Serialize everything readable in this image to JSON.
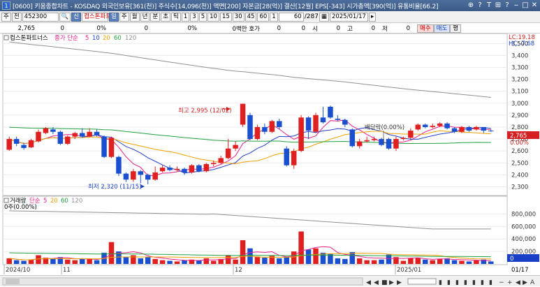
{
  "window": {
    "number": "1",
    "title": "[0600] 키움종합차트 - KOSDAQ 외국인보유[361(천)] 주식수[14,096(천)] 액면[200] 자본금[28(억)] 결산[12월] EPS[-343] 시가총액[390(억)] 유통비율[66.2]",
    "controls": [
      "⊕",
      "?",
      "T",
      "⊞",
      "?",
      "‒",
      "□",
      "✕"
    ]
  },
  "toolbar": {
    "market": "주",
    "period_mode": "전",
    "code": "452300",
    "stock_name": "컵스톤파트",
    "buttons": [
      "일",
      "주",
      "월",
      "년",
      "분",
      "초",
      "틱"
    ],
    "active_button": "일",
    "intervals": [
      "1",
      "3",
      "5",
      "10",
      "15",
      "30",
      "45",
      "60"
    ],
    "interval_dropdown": "1",
    "count_value": "60",
    "count_total": "/287",
    "date": "2025/01/17"
  },
  "infobar": {
    "price": "2,765",
    "change": "0",
    "change_pct": "0%",
    "volume": "0",
    "volume_pct": "0%",
    "ask_label": "0백만 호가",
    "ask_value": "0",
    "open_label": "시",
    "open_value": "0",
    "high_label": "고",
    "high_value": "0",
    "low_label": "저",
    "low_value": "0",
    "buy_label": "매수",
    "sell_label": "매도",
    "flat_label": "평"
  },
  "price_panel": {
    "legend_name": "컵스톤파트너스",
    "legend_ma_label": "종가 단순",
    "ma_periods": [
      "5",
      "10",
      "20",
      "60",
      "120"
    ],
    "ma_colors": [
      "#e8208a",
      "#2040c8",
      "#f0a000",
      "#20a040",
      "#909090"
    ],
    "lc_label": "LC:19.18",
    "hc_label": "HC:-7.68",
    "current_price_tag": "2,765",
    "current_pct_tag": "0.00%",
    "high_annotation": "최고 2,995 (12/02)",
    "low_annotation": "최저 2,320 (11/15)",
    "dividend_annotation": "배당락(0.00%)"
  },
  "volume_panel": {
    "legend_name": "거래량",
    "legend_ma_label": "단순",
    "ma_periods": [
      "5",
      "20",
      "60",
      "120"
    ],
    "sublabel": "0주(0.00%)",
    "current_tag": "0"
  },
  "x_axis": {
    "labels": [
      "2024/10",
      "11",
      "12",
      "2025/01"
    ],
    "right_label": "01/17"
  },
  "chart_data": {
    "type": "candlestick",
    "y_price_ticks": [
      "3,500",
      "3,400",
      "3,300",
      "3,200",
      "3,100",
      "3,000",
      "2,900",
      "2,800",
      "2,700",
      "2,600",
      "2,500",
      "2,400",
      "2,300"
    ],
    "y_volume_ticks": [
      "800,000",
      "600,000",
      "400,000",
      "200,000"
    ],
    "ylim_price": [
      2250,
      3560
    ],
    "ylim_volume": [
      0,
      950000
    ],
    "candles": [
      {
        "o": 2610,
        "c": 2700,
        "h": 2720,
        "l": 2600,
        "v": 90000
      },
      {
        "o": 2700,
        "c": 2660,
        "h": 2720,
        "l": 2640,
        "v": 60000
      },
      {
        "o": 2650,
        "c": 2625,
        "h": 2670,
        "l": 2610,
        "v": 50000
      },
      {
        "o": 2630,
        "c": 2690,
        "h": 2700,
        "l": 2625,
        "v": 70000
      },
      {
        "o": 2680,
        "c": 2760,
        "h": 2780,
        "l": 2670,
        "v": 140000
      },
      {
        "o": 2750,
        "c": 2790,
        "h": 2800,
        "l": 2740,
        "v": 100000
      },
      {
        "o": 2780,
        "c": 2760,
        "h": 2800,
        "l": 2740,
        "v": 80000
      },
      {
        "o": 2760,
        "c": 2660,
        "h": 2770,
        "l": 2650,
        "v": 110000
      },
      {
        "o": 2660,
        "c": 2720,
        "h": 2730,
        "l": 2650,
        "v": 70000
      },
      {
        "o": 2720,
        "c": 2750,
        "h": 2760,
        "l": 2700,
        "v": 60000
      },
      {
        "o": 2750,
        "c": 2720,
        "h": 2790,
        "l": 2710,
        "v": 90000
      },
      {
        "o": 2720,
        "c": 2760,
        "h": 2790,
        "l": 2715,
        "v": 80000
      },
      {
        "o": 2760,
        "c": 2730,
        "h": 2780,
        "l": 2720,
        "v": 60000
      },
      {
        "o": 2720,
        "c": 2550,
        "h": 2730,
        "l": 2540,
        "v": 180000
      },
      {
        "o": 2550,
        "c": 2710,
        "h": 2720,
        "l": 2540,
        "v": 350000
      },
      {
        "o": 2550,
        "c": 2410,
        "h": 2560,
        "l": 2390,
        "v": 200000
      },
      {
        "o": 2410,
        "c": 2360,
        "h": 2420,
        "l": 2340,
        "v": 110000
      },
      {
        "o": 2360,
        "c": 2430,
        "h": 2450,
        "l": 2340,
        "v": 140000
      },
      {
        "o": 2430,
        "c": 2400,
        "h": 2440,
        "l": 2330,
        "v": 90000
      },
      {
        "o": 2400,
        "c": 2360,
        "h": 2410,
        "l": 2320,
        "v": 110000
      },
      {
        "o": 2360,
        "c": 2420,
        "h": 2470,
        "l": 2350,
        "v": 80000
      },
      {
        "o": 2430,
        "c": 2460,
        "h": 2480,
        "l": 2420,
        "v": 60000
      },
      {
        "o": 2460,
        "c": 2440,
        "h": 2480,
        "l": 2430,
        "v": 50000
      },
      {
        "o": 2440,
        "c": 2450,
        "h": 2470,
        "l": 2430,
        "v": 40000
      },
      {
        "o": 2450,
        "c": 2420,
        "h": 2460,
        "l": 2400,
        "v": 60000
      },
      {
        "o": 2420,
        "c": 2480,
        "h": 2490,
        "l": 2410,
        "v": 70000
      },
      {
        "o": 2480,
        "c": 2430,
        "h": 2490,
        "l": 2420,
        "v": 60000
      },
      {
        "o": 2430,
        "c": 2490,
        "h": 2500,
        "l": 2420,
        "v": 90000
      },
      {
        "o": 2490,
        "c": 2500,
        "h": 2520,
        "l": 2470,
        "v": 50000
      },
      {
        "o": 2500,
        "c": 2540,
        "h": 2560,
        "l": 2490,
        "v": 80000
      },
      {
        "o": 2540,
        "c": 2620,
        "h": 2700,
        "l": 2530,
        "v": 140000
      },
      {
        "o": 2620,
        "c": 2650,
        "h": 2680,
        "l": 2600,
        "v": 70000
      },
      {
        "o": 2820,
        "c": 2995,
        "h": 2995,
        "l": 2800,
        "v": 380000
      },
      {
        "o": 2900,
        "c": 2700,
        "h": 2920,
        "l": 2690,
        "v": 250000
      },
      {
        "o": 2700,
        "c": 2800,
        "h": 2820,
        "l": 2690,
        "v": 120000
      },
      {
        "o": 2800,
        "c": 2760,
        "h": 2830,
        "l": 2740,
        "v": 100000
      },
      {
        "o": 2760,
        "c": 2850,
        "h": 2860,
        "l": 2750,
        "v": 130000
      },
      {
        "o": 2850,
        "c": 2800,
        "h": 2870,
        "l": 2780,
        "v": 90000
      },
      {
        "o": 2620,
        "c": 2480,
        "h": 2640,
        "l": 2470,
        "v": 120000
      },
      {
        "o": 2480,
        "c": 2600,
        "h": 2620,
        "l": 2450,
        "v": 200000
      },
      {
        "o": 2600,
        "c": 2880,
        "h": 2900,
        "l": 2590,
        "v": 520000
      },
      {
        "o": 2880,
        "c": 2770,
        "h": 2890,
        "l": 2700,
        "v": 230000
      },
      {
        "o": 2760,
        "c": 2900,
        "h": 2920,
        "l": 2750,
        "v": 250000
      },
      {
        "o": 2880,
        "c": 2840,
        "h": 2970,
        "l": 2830,
        "v": 180000
      },
      {
        "o": 2970,
        "c": 2880,
        "h": 2980,
        "l": 2870,
        "v": 160000
      },
      {
        "o": 2870,
        "c": 2860,
        "h": 2900,
        "l": 2850,
        "v": 90000
      },
      {
        "o": 2860,
        "c": 2820,
        "h": 2870,
        "l": 2800,
        "v": 80000
      },
      {
        "o": 2780,
        "c": 2640,
        "h": 2790,
        "l": 2630,
        "v": 190000
      },
      {
        "o": 2640,
        "c": 2680,
        "h": 2700,
        "l": 2620,
        "v": 90000
      },
      {
        "o": 2680,
        "c": 2690,
        "h": 2720,
        "l": 2670,
        "v": 60000
      },
      {
        "o": 2690,
        "c": 2700,
        "h": 2720,
        "l": 2680,
        "v": 60000
      },
      {
        "o": 2700,
        "c": 2650,
        "h": 2710,
        "l": 2640,
        "v": 70000
      },
      {
        "o": 2700,
        "c": 2620,
        "h": 2710,
        "l": 2610,
        "v": 150000
      },
      {
        "o": 2620,
        "c": 2700,
        "h": 2720,
        "l": 2600,
        "v": 110000
      },
      {
        "o": 2700,
        "c": 2710,
        "h": 2720,
        "l": 2690,
        "v": 50000
      },
      {
        "o": 2710,
        "c": 2770,
        "h": 2790,
        "l": 2700,
        "v": 90000
      },
      {
        "o": 2780,
        "c": 2820,
        "h": 2830,
        "l": 2770,
        "v": 100000
      },
      {
        "o": 2820,
        "c": 2800,
        "h": 2830,
        "l": 2790,
        "v": 70000
      },
      {
        "o": 2800,
        "c": 2810,
        "h": 2830,
        "l": 2790,
        "v": 60000
      },
      {
        "o": 2810,
        "c": 2830,
        "h": 2840,
        "l": 2800,
        "v": 80000
      },
      {
        "o": 2830,
        "c": 2790,
        "h": 2840,
        "l": 2780,
        "v": 90000
      },
      {
        "o": 2790,
        "c": 2760,
        "h": 2800,
        "l": 2750,
        "v": 60000
      },
      {
        "o": 2760,
        "c": 2800,
        "h": 2810,
        "l": 2750,
        "v": 50000
      },
      {
        "o": 2800,
        "c": 2770,
        "h": 2810,
        "l": 2760,
        "v": 40000
      },
      {
        "o": 2780,
        "c": 2800,
        "h": 2810,
        "l": 2770,
        "v": 60000
      },
      {
        "o": 2800,
        "c": 2770,
        "h": 2800,
        "l": 2750,
        "v": 70000
      },
      {
        "o": 2770,
        "c": 2765,
        "h": 2780,
        "l": 2760,
        "v": 40000
      }
    ]
  }
}
